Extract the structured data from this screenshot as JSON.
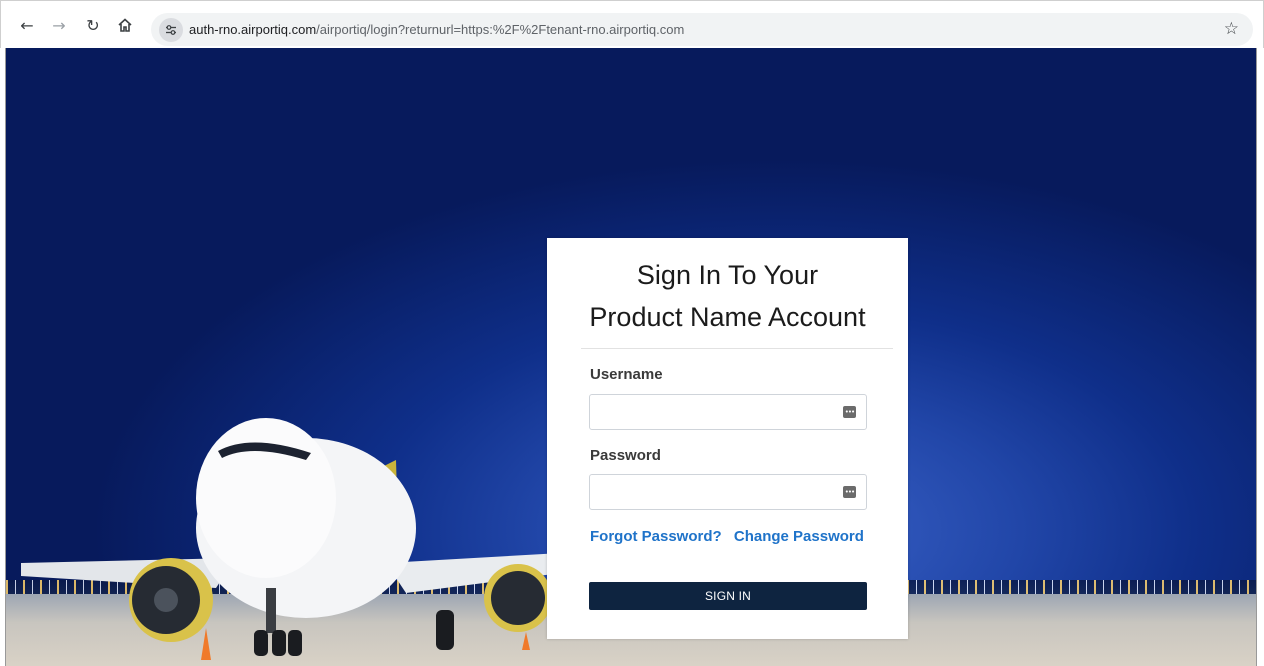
{
  "browser": {
    "url_host": "auth-rno.airportiq.com",
    "url_path": "/airportiq/login?returnurl=https:%2F%2Ftenant-rno.airportiq.com",
    "icons": [
      "back-arrow-icon",
      "forward-arrow-icon",
      "reload-icon",
      "home-icon",
      "site-info-icon",
      "bookmark-star-icon"
    ]
  },
  "login": {
    "title_line1": "Sign In To Your",
    "title_line2": "Product Name Account",
    "username_label": "Username",
    "username_value": "",
    "password_label": "Password",
    "password_value": "",
    "forgot_password": "Forgot Password?",
    "change_password": "Change Password",
    "signin_button": "SIGN IN"
  },
  "colors": {
    "signin_button_bg": "#0e2440",
    "link": "#1f73c9"
  }
}
